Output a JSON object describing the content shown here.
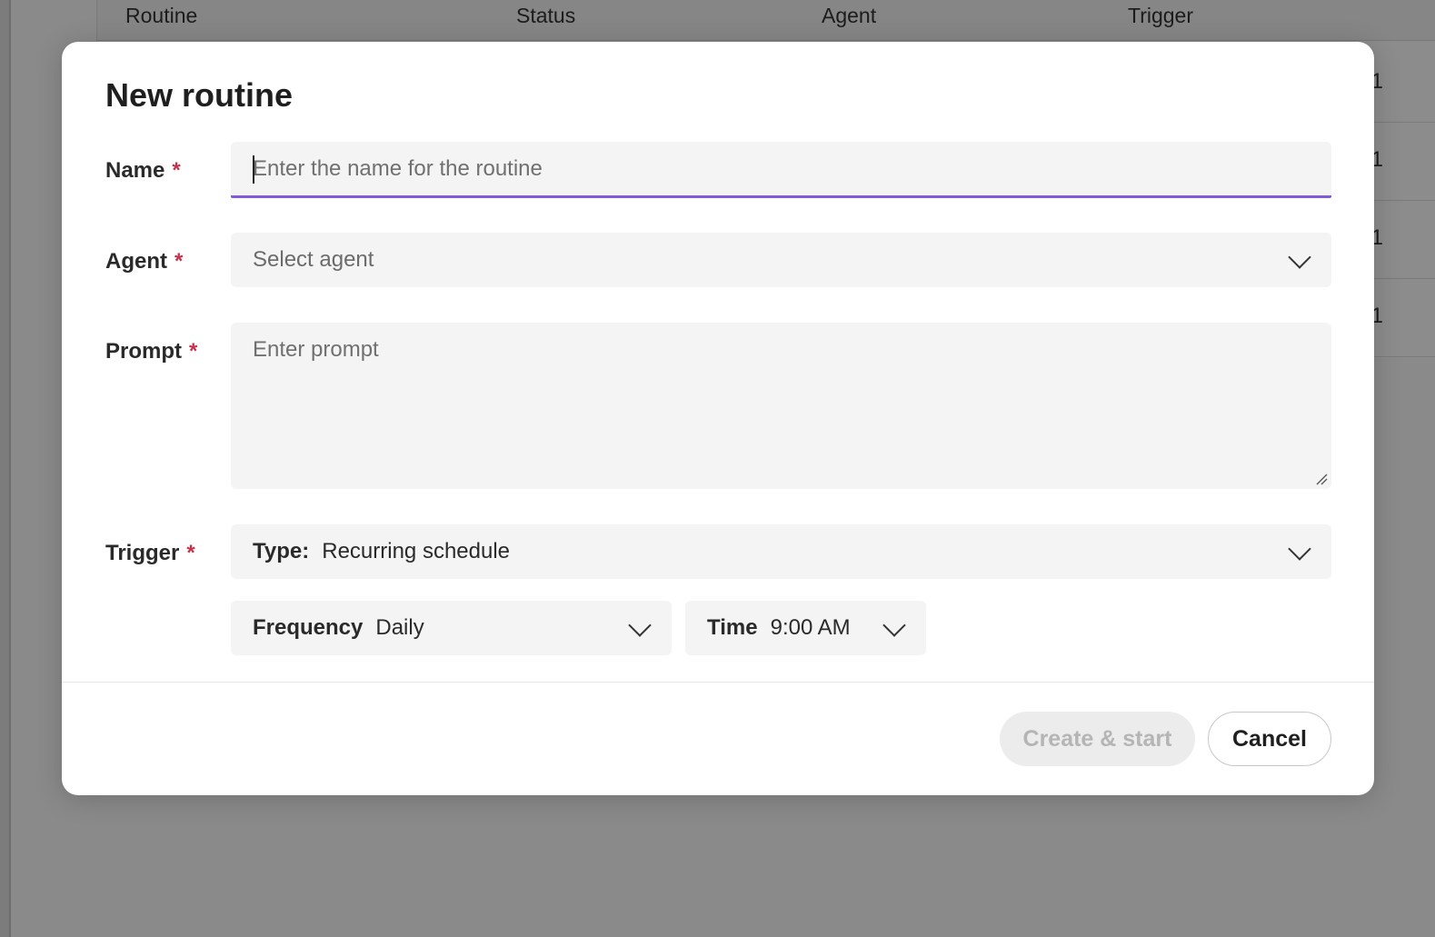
{
  "background": {
    "columns": [
      "Routine",
      "Status",
      "Agent",
      "Trigger"
    ],
    "row_values": [
      "1",
      "1",
      "1",
      "1"
    ]
  },
  "modal": {
    "title": "New routine",
    "required_mark": "*",
    "name": {
      "label": "Name",
      "placeholder": "Enter the name for the routine",
      "value": ""
    },
    "agent": {
      "label": "Agent",
      "placeholder": "Select agent"
    },
    "prompt": {
      "label": "Prompt",
      "placeholder": "Enter prompt",
      "value": ""
    },
    "trigger": {
      "label": "Trigger",
      "type_label": "Type:",
      "type_value": "Recurring schedule",
      "frequency_label": "Frequency",
      "frequency_value": "Daily",
      "time_label": "Time",
      "time_value": "9:00 AM"
    },
    "buttons": {
      "create": "Create & start",
      "cancel": "Cancel"
    }
  },
  "colors": {
    "accent": "#7f5bd5",
    "required": "#c4314b",
    "overlay": "#8a8a8a"
  }
}
